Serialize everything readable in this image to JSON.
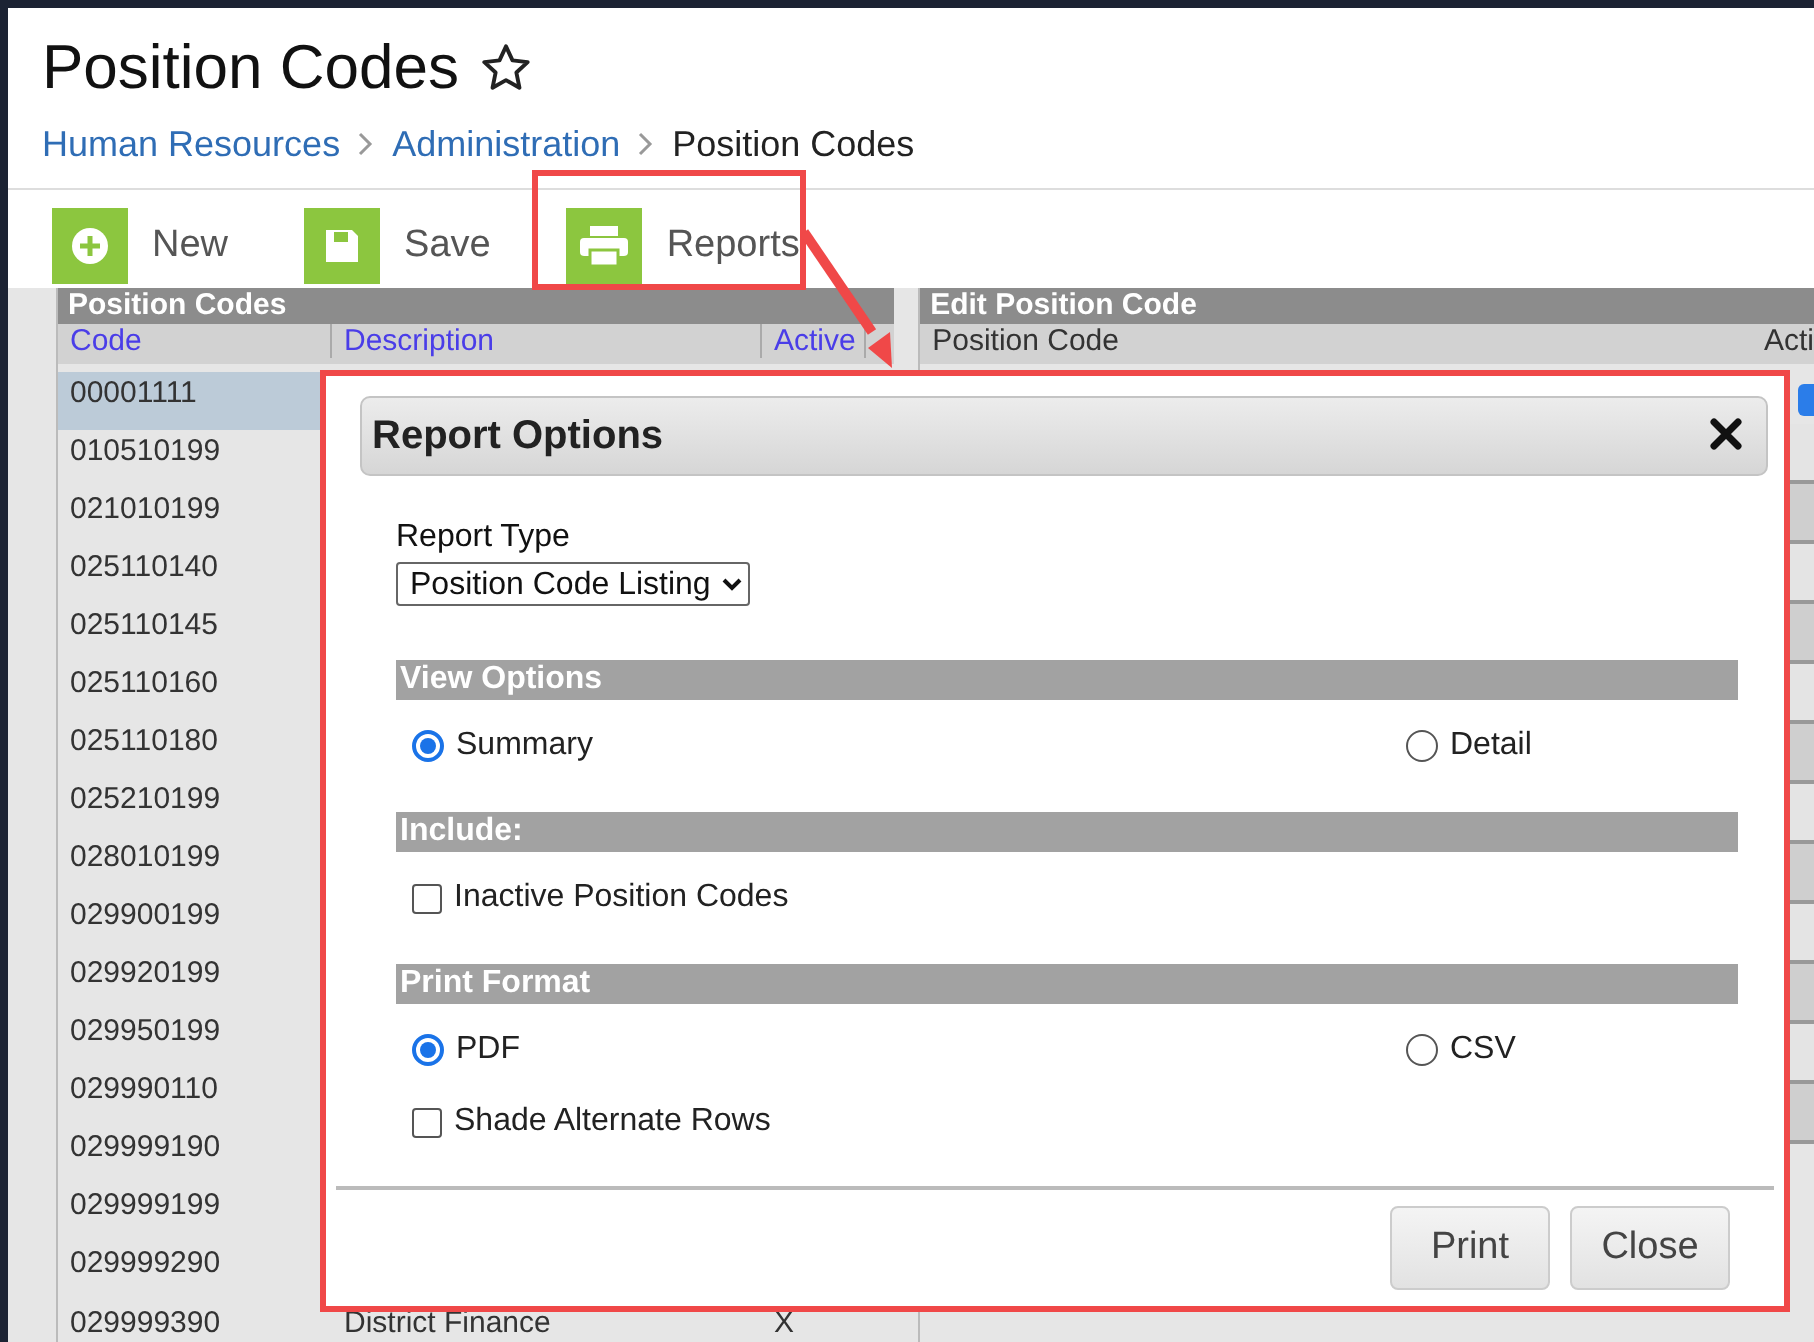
{
  "page": {
    "title": "Position Codes",
    "favorite": false
  },
  "breadcrumb": [
    {
      "label": "Human Resources",
      "link": true
    },
    {
      "label": "Administration",
      "link": true
    },
    {
      "label": "Position Codes",
      "link": false
    }
  ],
  "toolbar": [
    {
      "label": "New",
      "kind": "new",
      "highlighted": false
    },
    {
      "label": "Save",
      "kind": "save",
      "highlighted": false
    },
    {
      "label": "Reports",
      "kind": "reports",
      "highlighted": true
    }
  ],
  "list_panel": {
    "title": "Position Codes",
    "columns": [
      "Code",
      "Description",
      "Active"
    ],
    "rows": [
      {
        "code": "00001111",
        "selected": true
      },
      {
        "code": "010510199",
        "selected": false
      },
      {
        "code": "021010199",
        "selected": false
      },
      {
        "code": "025110140",
        "selected": false
      },
      {
        "code": "025110145",
        "selected": false
      },
      {
        "code": "025110160",
        "selected": false
      },
      {
        "code": "025110180",
        "selected": false
      },
      {
        "code": "025210199",
        "selected": false
      },
      {
        "code": "028010199",
        "selected": false
      },
      {
        "code": "029900199",
        "selected": false
      },
      {
        "code": "029920199",
        "selected": false
      },
      {
        "code": "029950199",
        "selected": false
      },
      {
        "code": "029990110",
        "selected": false
      },
      {
        "code": "029999190",
        "selected": false
      },
      {
        "code": "029999199",
        "selected": false
      },
      {
        "code": "029999290",
        "selected": false
      },
      {
        "code": "029999390",
        "description": "District Finance",
        "active": "X",
        "selected": false
      }
    ]
  },
  "edit_panel": {
    "title": "Edit Position Code",
    "fields": [
      "Position Code",
      "Acti"
    ],
    "active_checked": true
  },
  "dialog": {
    "title": "Report Options",
    "report_type": {
      "label": "Report Type",
      "value": "Position Code Listing"
    },
    "sections": [
      {
        "title": "View Options",
        "options": [
          {
            "kind": "radio",
            "label": "Summary",
            "selected": true
          },
          {
            "kind": "radio",
            "label": "Detail",
            "selected": false
          }
        ]
      },
      {
        "title": "Include:",
        "options": [
          {
            "kind": "checkbox",
            "label": "Inactive Position Codes",
            "checked": false
          }
        ]
      },
      {
        "title": "Print Format",
        "options": [
          {
            "kind": "radio",
            "label": "PDF",
            "selected": true
          },
          {
            "kind": "radio",
            "label": "CSV",
            "selected": false
          },
          {
            "kind": "checkbox",
            "label": "Shade Alternate Rows",
            "checked": false
          }
        ]
      }
    ],
    "buttons": [
      "Print",
      "Close"
    ]
  }
}
